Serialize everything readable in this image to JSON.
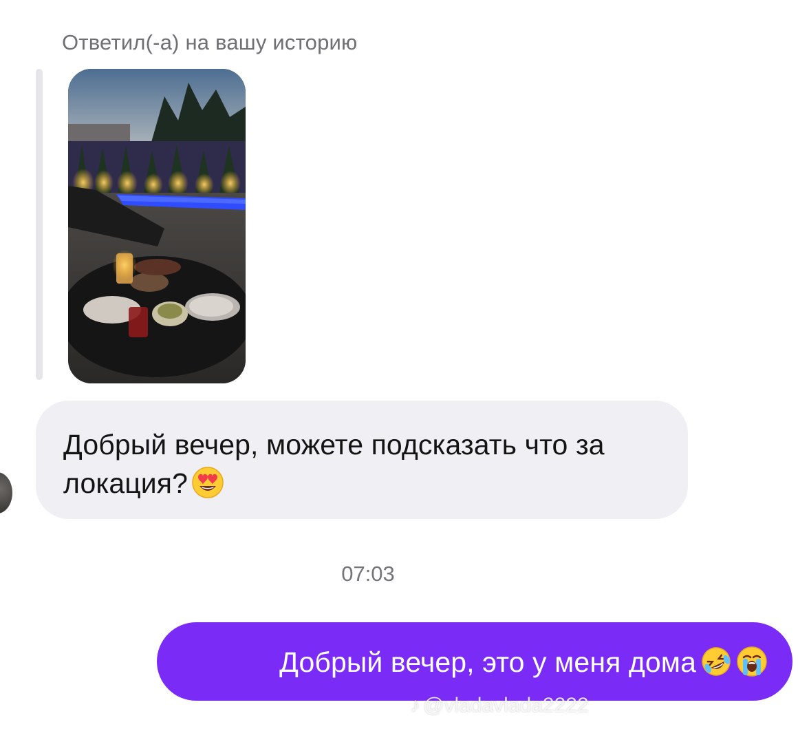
{
  "story_reply": {
    "caption": "Ответил(-а) на вашу историю",
    "thumbnail_alt": "night-patio-pool-photo"
  },
  "messages": [
    {
      "direction": "incoming",
      "text": "Добрый вечер, можете подсказать что за локация?",
      "emoji": [
        "heart-eyes-emoji"
      ]
    },
    {
      "direction": "outgoing",
      "text": "Добрый вечер, это у меня дома",
      "emoji": [
        "rolling-laughing-emoji",
        "loudly-crying-emoji"
      ]
    }
  ],
  "timestamp": "07:03",
  "watermark": {
    "icon": "tiktok-note-icon",
    "handle": "@vladavlada2222"
  },
  "colors": {
    "outgoing_bubble": "#7a2cf6",
    "incoming_bubble": "#efeff4"
  }
}
